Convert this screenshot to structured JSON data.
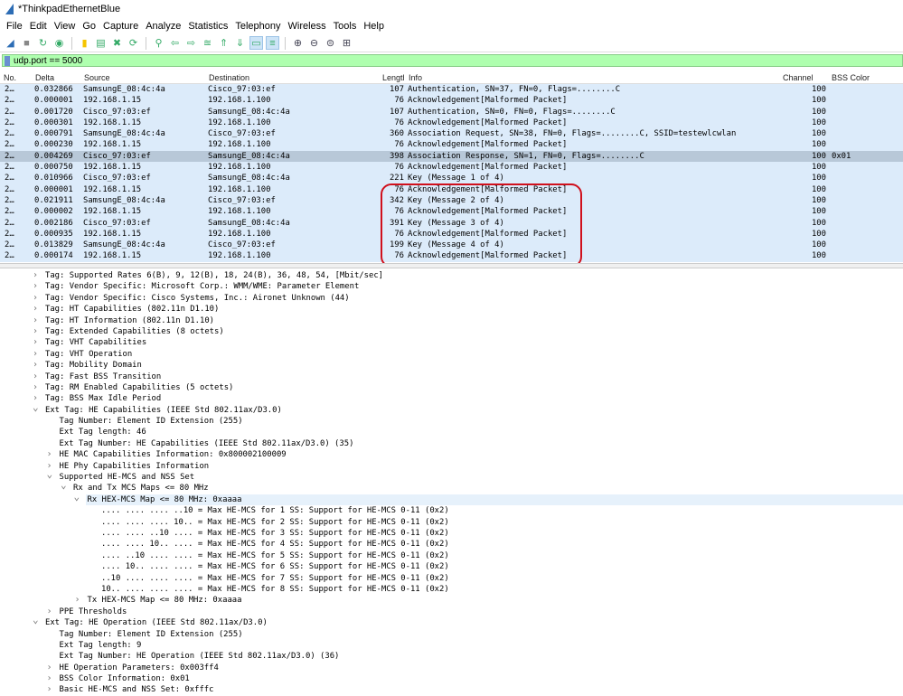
{
  "window": {
    "title": "*ThinkpadEthernetBlue"
  },
  "menu": [
    "File",
    "Edit",
    "View",
    "Go",
    "Capture",
    "Analyze",
    "Statistics",
    "Telephony",
    "Wireless",
    "Tools",
    "Help"
  ],
  "toolbar": [
    "shark-fin-start-icon",
    "stop-icon",
    "restart-icon",
    "options-icon",
    "open-file-icon",
    "save-file-icon",
    "close-file-icon",
    "reload-icon",
    "find-icon",
    "back-icon",
    "forward-icon",
    "go-to-packet-icon",
    "first-packet-icon",
    "last-packet-icon",
    "autoscroll-icon",
    "colorize-icon",
    "zoom-in-icon",
    "zoom-out-icon",
    "normal-size-icon",
    "resize-columns-icon"
  ],
  "filter": {
    "value": "udp.port == 5000"
  },
  "columns": [
    "No.",
    "Delta",
    "Source",
    "Destination",
    "Length",
    "Info",
    "Channel",
    "BSS Color"
  ],
  "packets": [
    {
      "no": "2…",
      "delta": "0.032866",
      "src": "SamsungE_08:4c:4a",
      "dst": "Cisco_97:03:ef",
      "len": "107",
      "info": "Authentication, SN=37, FN=0, Flags=........C",
      "ch": "100",
      "bss": ""
    },
    {
      "no": "2…",
      "delta": "0.000001",
      "src": "192.168.1.15",
      "dst": "192.168.1.100",
      "len": "76",
      "info": "Acknowledgement[Malformed Packet]",
      "ch": "100",
      "bss": ""
    },
    {
      "no": "2…",
      "delta": "0.001720",
      "src": "Cisco_97:03:ef",
      "dst": "SamsungE_08:4c:4a",
      "len": "107",
      "info": "Authentication, SN=0, FN=0, Flags=........C",
      "ch": "100",
      "bss": ""
    },
    {
      "no": "2…",
      "delta": "0.000301",
      "src": "192.168.1.15",
      "dst": "192.168.1.100",
      "len": "76",
      "info": "Acknowledgement[Malformed Packet]",
      "ch": "100",
      "bss": ""
    },
    {
      "no": "2…",
      "delta": "0.000791",
      "src": "SamsungE_08:4c:4a",
      "dst": "Cisco_97:03:ef",
      "len": "360",
      "info": "Association Request, SN=38, FN=0, Flags=........C, SSID=testewlcwlan",
      "ch": "100",
      "bss": ""
    },
    {
      "no": "2…",
      "delta": "0.000230",
      "src": "192.168.1.15",
      "dst": "192.168.1.100",
      "len": "76",
      "info": "Acknowledgement[Malformed Packet]",
      "ch": "100",
      "bss": ""
    },
    {
      "no": "2…",
      "delta": "0.004269",
      "src": "Cisco_97:03:ef",
      "dst": "SamsungE_08:4c:4a",
      "len": "398",
      "info": "Association Response, SN=1, FN=0, Flags=........C",
      "ch": "100",
      "bss": "0x01",
      "selected": true
    },
    {
      "no": "2…",
      "delta": "0.000750",
      "src": "192.168.1.15",
      "dst": "192.168.1.100",
      "len": "76",
      "info": "Acknowledgement[Malformed Packet]",
      "ch": "100",
      "bss": ""
    },
    {
      "no": "2…",
      "delta": "0.010966",
      "src": "Cisco_97:03:ef",
      "dst": "SamsungE_08:4c:4a",
      "len": "221",
      "info": "Key (Message 1 of 4)",
      "ch": "100",
      "bss": ""
    },
    {
      "no": "2…",
      "delta": "0.000001",
      "src": "192.168.1.15",
      "dst": "192.168.1.100",
      "len": "76",
      "info": "Acknowledgement[Malformed Packet]",
      "ch": "100",
      "bss": ""
    },
    {
      "no": "2…",
      "delta": "0.021911",
      "src": "SamsungE_08:4c:4a",
      "dst": "Cisco_97:03:ef",
      "len": "342",
      "info": "Key (Message 2 of 4)",
      "ch": "100",
      "bss": ""
    },
    {
      "no": "2…",
      "delta": "0.000002",
      "src": "192.168.1.15",
      "dst": "192.168.1.100",
      "len": "76",
      "info": "Acknowledgement[Malformed Packet]",
      "ch": "100",
      "bss": ""
    },
    {
      "no": "2…",
      "delta": "0.002186",
      "src": "Cisco_97:03:ef",
      "dst": "SamsungE_08:4c:4a",
      "len": "391",
      "info": "Key (Message 3 of 4)",
      "ch": "100",
      "bss": ""
    },
    {
      "no": "2…",
      "delta": "0.000935",
      "src": "192.168.1.15",
      "dst": "192.168.1.100",
      "len": "76",
      "info": "Acknowledgement[Malformed Packet]",
      "ch": "100",
      "bss": ""
    },
    {
      "no": "2…",
      "delta": "0.013829",
      "src": "SamsungE_08:4c:4a",
      "dst": "Cisco_97:03:ef",
      "len": "199",
      "info": "Key (Message 4 of 4)",
      "ch": "100",
      "bss": ""
    },
    {
      "no": "2…",
      "delta": "0.000174",
      "src": "192.168.1.15",
      "dst": "192.168.1.100",
      "len": "76",
      "info": "Acknowledgement[Malformed Packet]",
      "ch": "100",
      "bss": ""
    }
  ],
  "details": [
    {
      "l": 0,
      "a": ">",
      "t": "Tag: Supported Rates 6(B), 9, 12(B), 18, 24(B), 36, 48, 54, [Mbit/sec]"
    },
    {
      "l": 0,
      "a": ">",
      "t": "Tag: Vendor Specific: Microsoft Corp.: WMM/WME: Parameter Element"
    },
    {
      "l": 0,
      "a": ">",
      "t": "Tag: Vendor Specific: Cisco Systems, Inc.: Aironet Unknown (44)"
    },
    {
      "l": 0,
      "a": ">",
      "t": "Tag: HT Capabilities (802.11n D1.10)"
    },
    {
      "l": 0,
      "a": ">",
      "t": "Tag: HT Information (802.11n D1.10)"
    },
    {
      "l": 0,
      "a": ">",
      "t": "Tag: Extended Capabilities (8 octets)"
    },
    {
      "l": 0,
      "a": ">",
      "t": "Tag: VHT Capabilities"
    },
    {
      "l": 0,
      "a": ">",
      "t": "Tag: VHT Operation"
    },
    {
      "l": 0,
      "a": ">",
      "t": "Tag: Mobility Domain"
    },
    {
      "l": 0,
      "a": ">",
      "t": "Tag: Fast BSS Transition"
    },
    {
      "l": 0,
      "a": ">",
      "t": "Tag: RM Enabled Capabilities (5 octets)"
    },
    {
      "l": 0,
      "a": ">",
      "t": "Tag: BSS Max Idle Period"
    },
    {
      "l": 0,
      "a": "v",
      "t": "Ext Tag: HE Capabilities (IEEE Std 802.11ax/D3.0)"
    },
    {
      "l": 1,
      "a": "",
      "t": "Tag Number: Element ID Extension (255)"
    },
    {
      "l": 1,
      "a": "",
      "t": "Ext Tag length: 46"
    },
    {
      "l": 1,
      "a": "",
      "t": "Ext Tag Number: HE Capabilities (IEEE Std 802.11ax/D3.0) (35)"
    },
    {
      "l": 1,
      "a": ">",
      "t": "HE MAC Capabilities Information: 0x800002100009"
    },
    {
      "l": 1,
      "a": ">",
      "t": "HE Phy Capabilities Information"
    },
    {
      "l": 1,
      "a": "v",
      "t": "Supported HE-MCS and NSS Set"
    },
    {
      "l": 2,
      "a": "v",
      "t": "Rx and Tx MCS Maps <= 80 MHz"
    },
    {
      "l": 3,
      "a": "v",
      "t": "Rx HEX-MCS Map <= 80 MHz: 0xaaaa",
      "hl": true
    },
    {
      "l": 4,
      "a": "",
      "t": ".... .... .... ..10 = Max HE-MCS for 1 SS: Support for HE-MCS 0-11 (0x2)"
    },
    {
      "l": 4,
      "a": "",
      "t": ".... .... .... 10.. = Max HE-MCS for 2 SS: Support for HE-MCS 0-11 (0x2)"
    },
    {
      "l": 4,
      "a": "",
      "t": ".... .... ..10 .... = Max HE-MCS for 3 SS: Support for HE-MCS 0-11 (0x2)"
    },
    {
      "l": 4,
      "a": "",
      "t": ".... .... 10.. .... = Max HE-MCS for 4 SS: Support for HE-MCS 0-11 (0x2)"
    },
    {
      "l": 4,
      "a": "",
      "t": ".... ..10 .... .... = Max HE-MCS for 5 SS: Support for HE-MCS 0-11 (0x2)"
    },
    {
      "l": 4,
      "a": "",
      "t": ".... 10.. .... .... = Max HE-MCS for 6 SS: Support for HE-MCS 0-11 (0x2)"
    },
    {
      "l": 4,
      "a": "",
      "t": "..10 .... .... .... = Max HE-MCS for 7 SS: Support for HE-MCS 0-11 (0x2)"
    },
    {
      "l": 4,
      "a": "",
      "t": "10.. .... .... .... = Max HE-MCS for 8 SS: Support for HE-MCS 0-11 (0x2)"
    },
    {
      "l": 3,
      "a": ">",
      "t": "Tx HEX-MCS Map <= 80 MHz: 0xaaaa"
    },
    {
      "l": 1,
      "a": ">",
      "t": "PPE Thresholds"
    },
    {
      "l": 0,
      "a": "v",
      "t": "Ext Tag: HE Operation (IEEE Std 802.11ax/D3.0)"
    },
    {
      "l": 1,
      "a": "",
      "t": "Tag Number: Element ID Extension (255)"
    },
    {
      "l": 1,
      "a": "",
      "t": "Ext Tag length: 9"
    },
    {
      "l": 1,
      "a": "",
      "t": "Ext Tag Number: HE Operation (IEEE Std 802.11ax/D3.0) (36)"
    },
    {
      "l": 1,
      "a": ">",
      "t": "HE Operation Parameters: 0x003ff4"
    },
    {
      "l": 1,
      "a": ">",
      "t": "BSS Color Information: 0x01"
    },
    {
      "l": 1,
      "a": ">",
      "t": "Basic HE-MCS and NSS Set: 0xfffc"
    }
  ],
  "colors": {
    "row_bg": "#dcebfa",
    "selected_row": "#b8c8d8",
    "filter_bg": "#afffaf",
    "highlight_box": "#d0101c"
  }
}
